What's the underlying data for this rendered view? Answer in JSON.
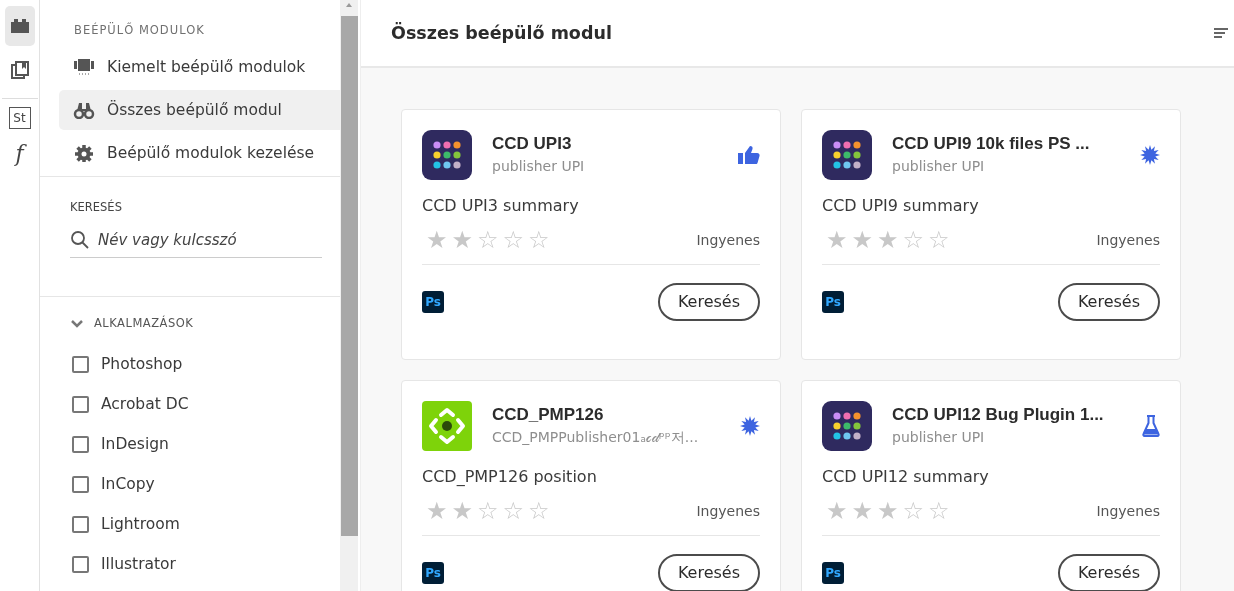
{
  "rail": [
    {
      "kind": "plugin",
      "selected": true
    },
    {
      "kind": "book",
      "selected": false
    },
    {
      "kind": "stock",
      "label": "St",
      "selected": false
    },
    {
      "kind": "font",
      "label": "f",
      "selected": false
    }
  ],
  "sidebar": {
    "heading": "BEÉPÜLŐ MODULOK",
    "items": [
      {
        "kind": "featured",
        "label": "Kiemelt beépülő modulok",
        "selected": false
      },
      {
        "kind": "all",
        "label": "Összes beépülő modul",
        "selected": true
      },
      {
        "kind": "manage",
        "label": "Beépülő modulok kezelése",
        "selected": false
      }
    ],
    "search": {
      "label": "KERESÉS",
      "placeholder": "Név vagy kulcsszó"
    },
    "apps": {
      "label": "ALKALMAZÁSOK",
      "expanded": true,
      "items": [
        {
          "label": "Photoshop",
          "checked": false
        },
        {
          "label": "Acrobat DC",
          "checked": false
        },
        {
          "label": "InDesign",
          "checked": false
        },
        {
          "label": "InCopy",
          "checked": false
        },
        {
          "label": "Lightroom",
          "checked": false
        },
        {
          "label": "Illustrator",
          "checked": false
        }
      ]
    }
  },
  "main": {
    "title": "Összes beépülő modul",
    "cards": [
      {
        "kind": "grid",
        "name": "CCD UPI3",
        "publisher": "publisher UPI",
        "badge": {
          "kind": "thumb"
        },
        "summary": "CCD UPI3 summary",
        "stars": 2,
        "price": "Ingyenes",
        "app": "Ps",
        "button": "Keresés"
      },
      {
        "kind": "grid",
        "name": "CCD UPI9 10k files PS ...",
        "publisher": "publisher UPI",
        "badge": {
          "kind": "burst"
        },
        "summary": "CCD UPI9 summary",
        "stars": 3,
        "price": "Ingyenes",
        "app": "Ps",
        "button": "Keresés"
      },
      {
        "kind": "target",
        "name": "CCD_PMP126",
        "publisher": "CCD_PMPPublisher01ₐ𝒸𝒹ᵖᵖ저...",
        "badge": {
          "kind": "burst"
        },
        "summary": "CCD_PMP126 position",
        "stars": 2,
        "price": "Ingyenes",
        "app": "Ps",
        "button": "Keresés"
      },
      {
        "kind": "grid",
        "name": "CCD UPI12 Bug Plugin 1...",
        "publisher": "publisher UPI",
        "badge": {
          "kind": "flask"
        },
        "summary": "CCD UPI12 summary",
        "stars": 3,
        "price": "Ingyenes",
        "app": "Ps",
        "button": "Keresés"
      }
    ]
  }
}
